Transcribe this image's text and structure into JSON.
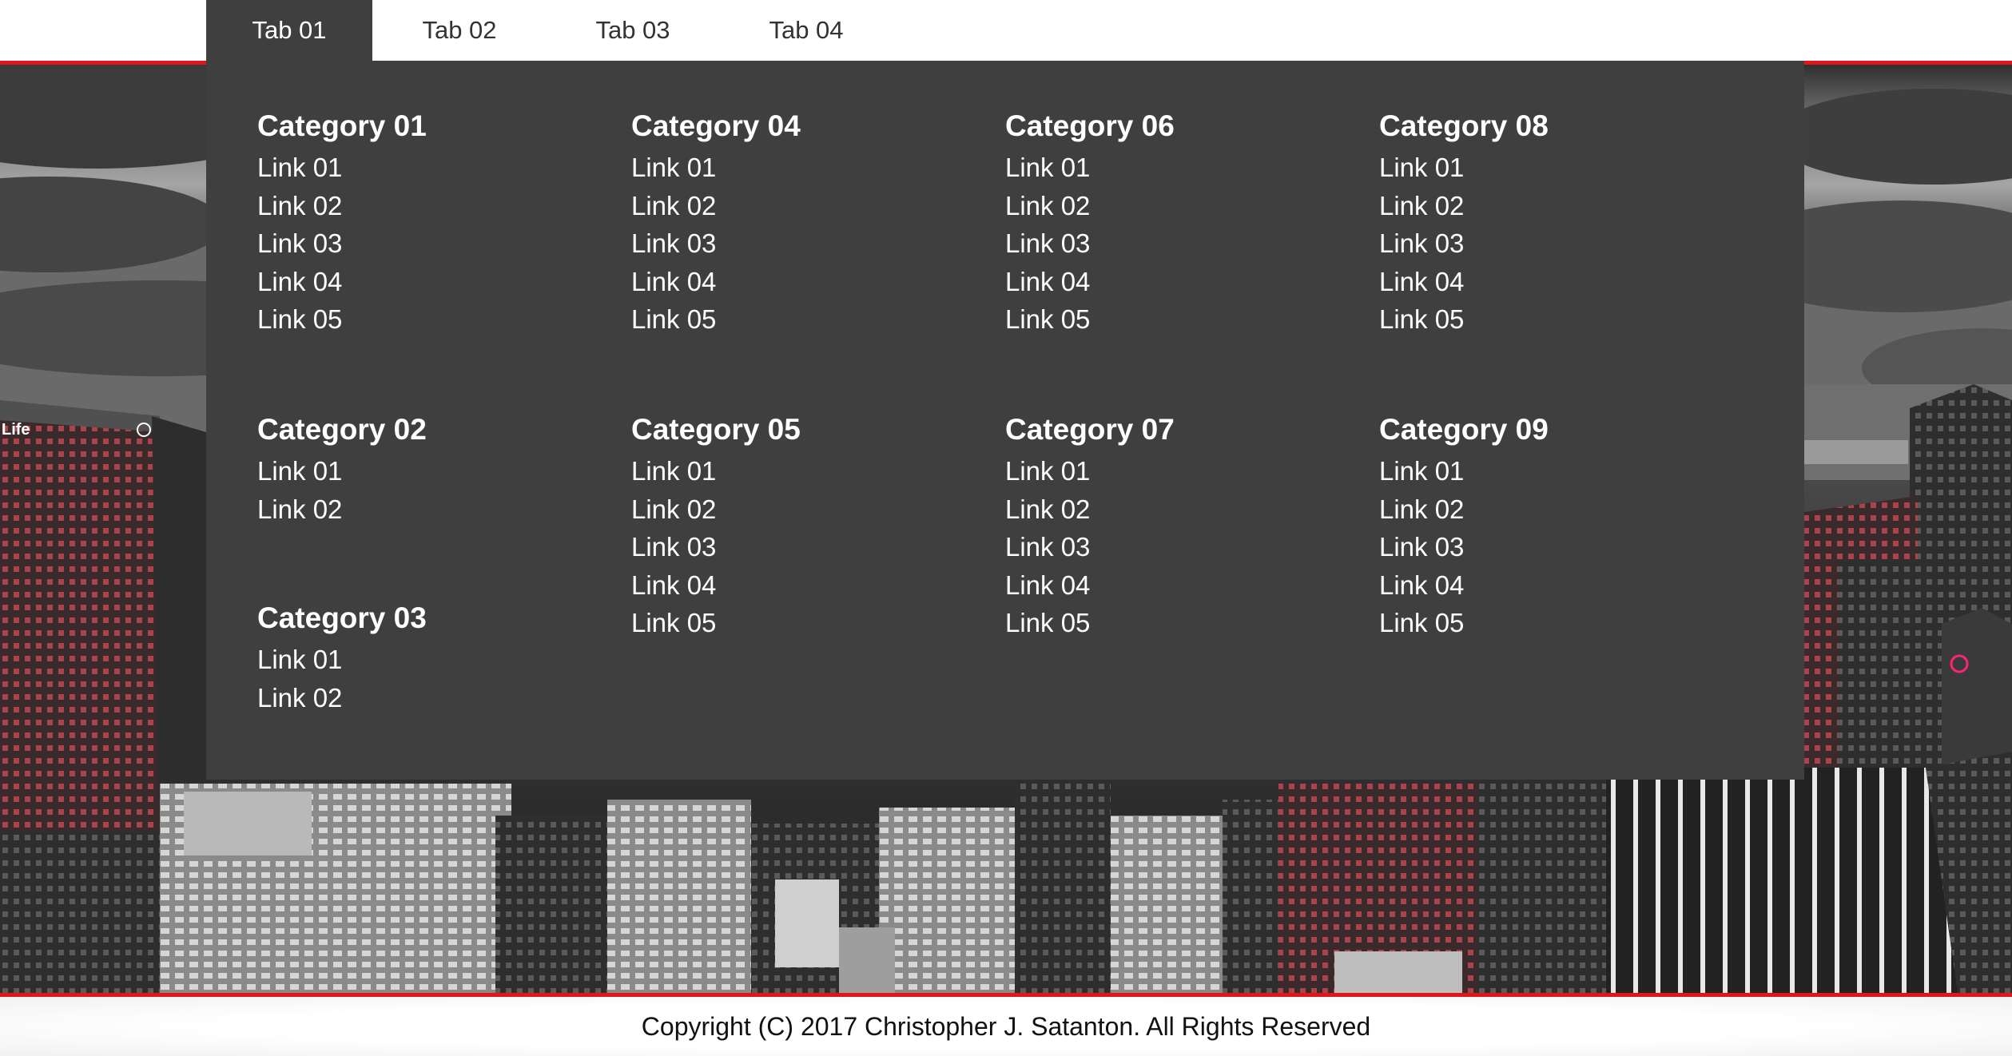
{
  "tabs": [
    {
      "label": "Tab 01",
      "active": true
    },
    {
      "label": "Tab 02",
      "active": false
    },
    {
      "label": "Tab 03",
      "active": false
    },
    {
      "label": "Tab 04",
      "active": false
    }
  ],
  "menu": {
    "categories": [
      {
        "title": "Category 01",
        "links": [
          "Link 01",
          "Link 02",
          "Link 03",
          "Link 04",
          "Link 05"
        ]
      },
      {
        "title": "Category 02",
        "links": [
          "Link 01",
          "Link 02"
        ]
      },
      {
        "title": "Category 03",
        "links": [
          "Link 01",
          "Link 02"
        ]
      },
      {
        "title": "Category 04",
        "links": [
          "Link 01",
          "Link 02",
          "Link 03",
          "Link 04",
          "Link 05"
        ]
      },
      {
        "title": "Category 05",
        "links": [
          "Link 01",
          "Link 02",
          "Link 03",
          "Link 04",
          "Link 05"
        ]
      },
      {
        "title": "Category 06",
        "links": [
          "Link 01",
          "Link 02",
          "Link 03",
          "Link 04",
          "Link 05"
        ]
      },
      {
        "title": "Category 07",
        "links": [
          "Link 01",
          "Link 02",
          "Link 03",
          "Link 04",
          "Link 05"
        ]
      },
      {
        "title": "Category 08",
        "links": [
          "Link 01",
          "Link 02",
          "Link 03",
          "Link 04",
          "Link 05"
        ]
      },
      {
        "title": "Category 09",
        "links": [
          "Link 01",
          "Link 02",
          "Link 03",
          "Link 04",
          "Link 05"
        ]
      }
    ]
  },
  "hero": {
    "sign_text": "Life"
  },
  "footer": {
    "copyright": "Copyright (C) 2017 Christopher J. Satanton. All Rights Reserved"
  },
  "colors": {
    "accent_red": "#e1161c",
    "panel_bg": "#3f3f3f",
    "active_tab_bg": "#3f3f3f",
    "window_light": "#ff5a5f"
  }
}
